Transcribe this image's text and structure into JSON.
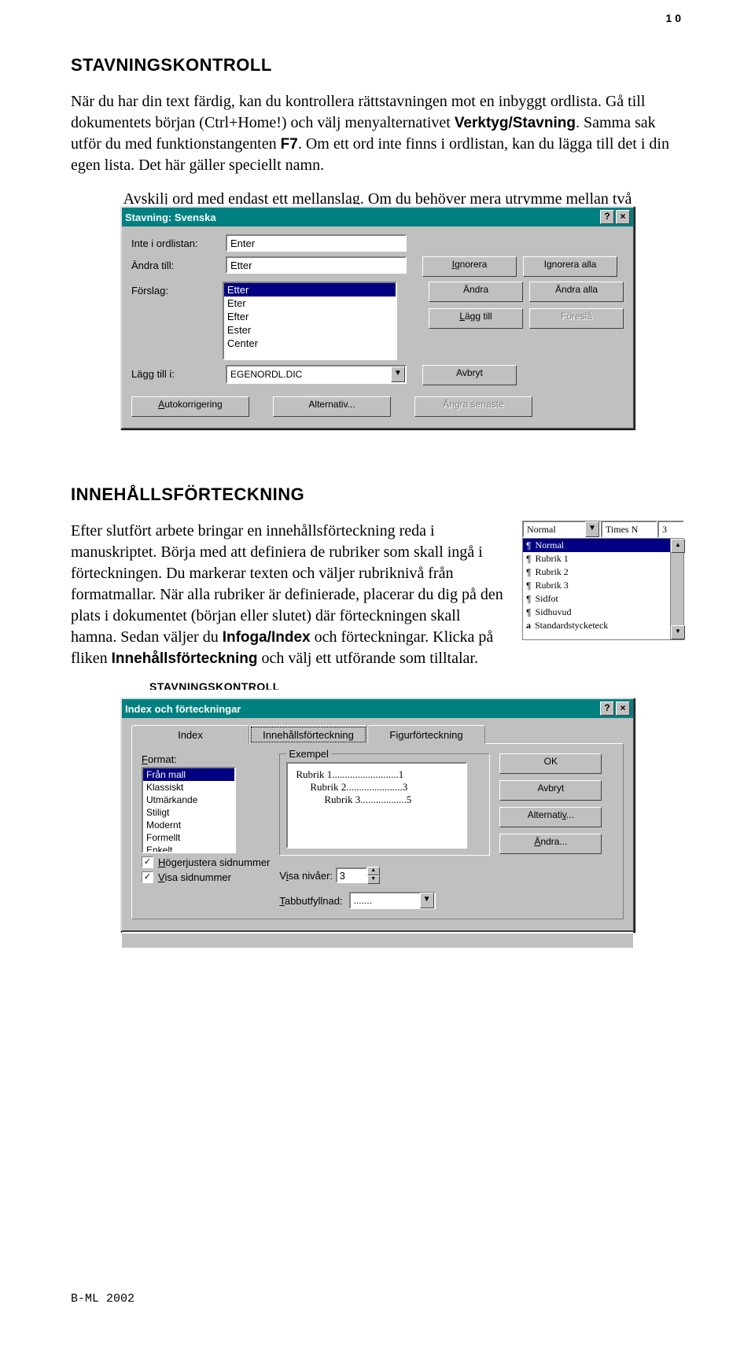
{
  "page_number": "10",
  "footer": "B-ML 2002",
  "section1": {
    "heading": "STAVNINGSKONTROLL",
    "p1a": "När du har din text färdig, kan du kontrollera rättstavningen mot en inbyggt ordlista. Gå till dokumentets början (Ctrl+Home!) och välj menyalternativet ",
    "p1b": "Verktyg/Stavning",
    "p1c": ". Samma sak utför du med funktionstangenten ",
    "p1d": "F7",
    "p1e": ". Om ett ord inte finns i ordlistan, kan du lägga till det i din egen lista. Det här gäller speciellt namn.",
    "cutline": "Avskilj ord med endast ett mellanslag. Om du behöver mera utrymme mellan två"
  },
  "spellcheck": {
    "title": "Stavning: Svenska",
    "lbl_not_in": "Inte i ordlistan:",
    "lbl_change_to": "Ändra till:",
    "lbl_suggest": "Förslag:",
    "lbl_add_to": "Lägg till i:",
    "val_not_in": "Enter",
    "val_change_to": "Etter",
    "suggestions": [
      "Etter",
      "Eter",
      "Efter",
      "Ester",
      "Center"
    ],
    "val_add_to": "EGENORDL.DIC",
    "btn_ignore": "Ignorera",
    "btn_ignore_all": "Ignorera alla",
    "btn_change": "Ändra",
    "btn_change_all": "Ändra alla",
    "btn_add": "Lägg till",
    "btn_suggest": "Föreslå",
    "btn_cancel": "Avbryt",
    "btn_autocorrect": "Autokorrigering",
    "btn_options": "Alternativ...",
    "btn_undo": "Ångra senaste"
  },
  "section2": {
    "heading": "INNEHÅLLSFÖRTECKNING",
    "p1": "Efter slutfört arbete bringar en innehållsförteckning reda i manuskriptet. Börja med att definiera de rubriker som skall ingå i förteckningen. Du markerar texten och väljer rubriknivå från formatmallar. När alla rubriker är definierade, placerar du dig på den plats i dokumentet (början eller slutet) där förteckningen skall hamna. Sedan väljer du ",
    "p1b": "Infoga/Index",
    "p1c": " och förteckningar. Klicka på fliken ",
    "p1d": "Innehållsförteckning",
    "p1e": " och välj ett utförande som tilltalar.",
    "cut_below": "STAVNINGSKONTROLL"
  },
  "style_panel": {
    "combo1": "Normal",
    "combo2": "Times N",
    "combo3": "3",
    "items": [
      "Normal",
      "Rubrik 1",
      "Rubrik 2",
      "Rubrik 3",
      "Sidfot",
      "Sidhuvud",
      "Standardstycketeck"
    ]
  },
  "index_dialog": {
    "title": "Index och förteckningar",
    "tab1": "Index",
    "tab2": "Innehållsförteckning",
    "tab3": "Figurförteckning",
    "lbl_format": "Format:",
    "formats": [
      "Från mall",
      "Klassiskt",
      "Utmärkande",
      "Stiligt",
      "Modernt",
      "Formellt",
      "Enkelt"
    ],
    "lbl_example": "Exempel",
    "preview_lines": [
      {
        "t": "Rubrik 1",
        "dots": "..........................",
        "n": "1"
      },
      {
        "t": "Rubrik 2",
        "dots": "......................",
        "n": "3"
      },
      {
        "t": "Rubrik 3",
        "dots": "..................",
        "n": "5"
      }
    ],
    "btn_ok": "OK",
    "btn_cancel": "Avbryt",
    "btn_options": "Alternativ...",
    "btn_modify": "Ändra...",
    "chk_right_align": "Högerjustera sidnummer",
    "chk_show_pn": "Visa sidnummer",
    "lbl_levels": "Visa nivåer:",
    "val_levels": "3",
    "lbl_leader": "Tabbutfyllnad:",
    "val_leader": "......."
  }
}
